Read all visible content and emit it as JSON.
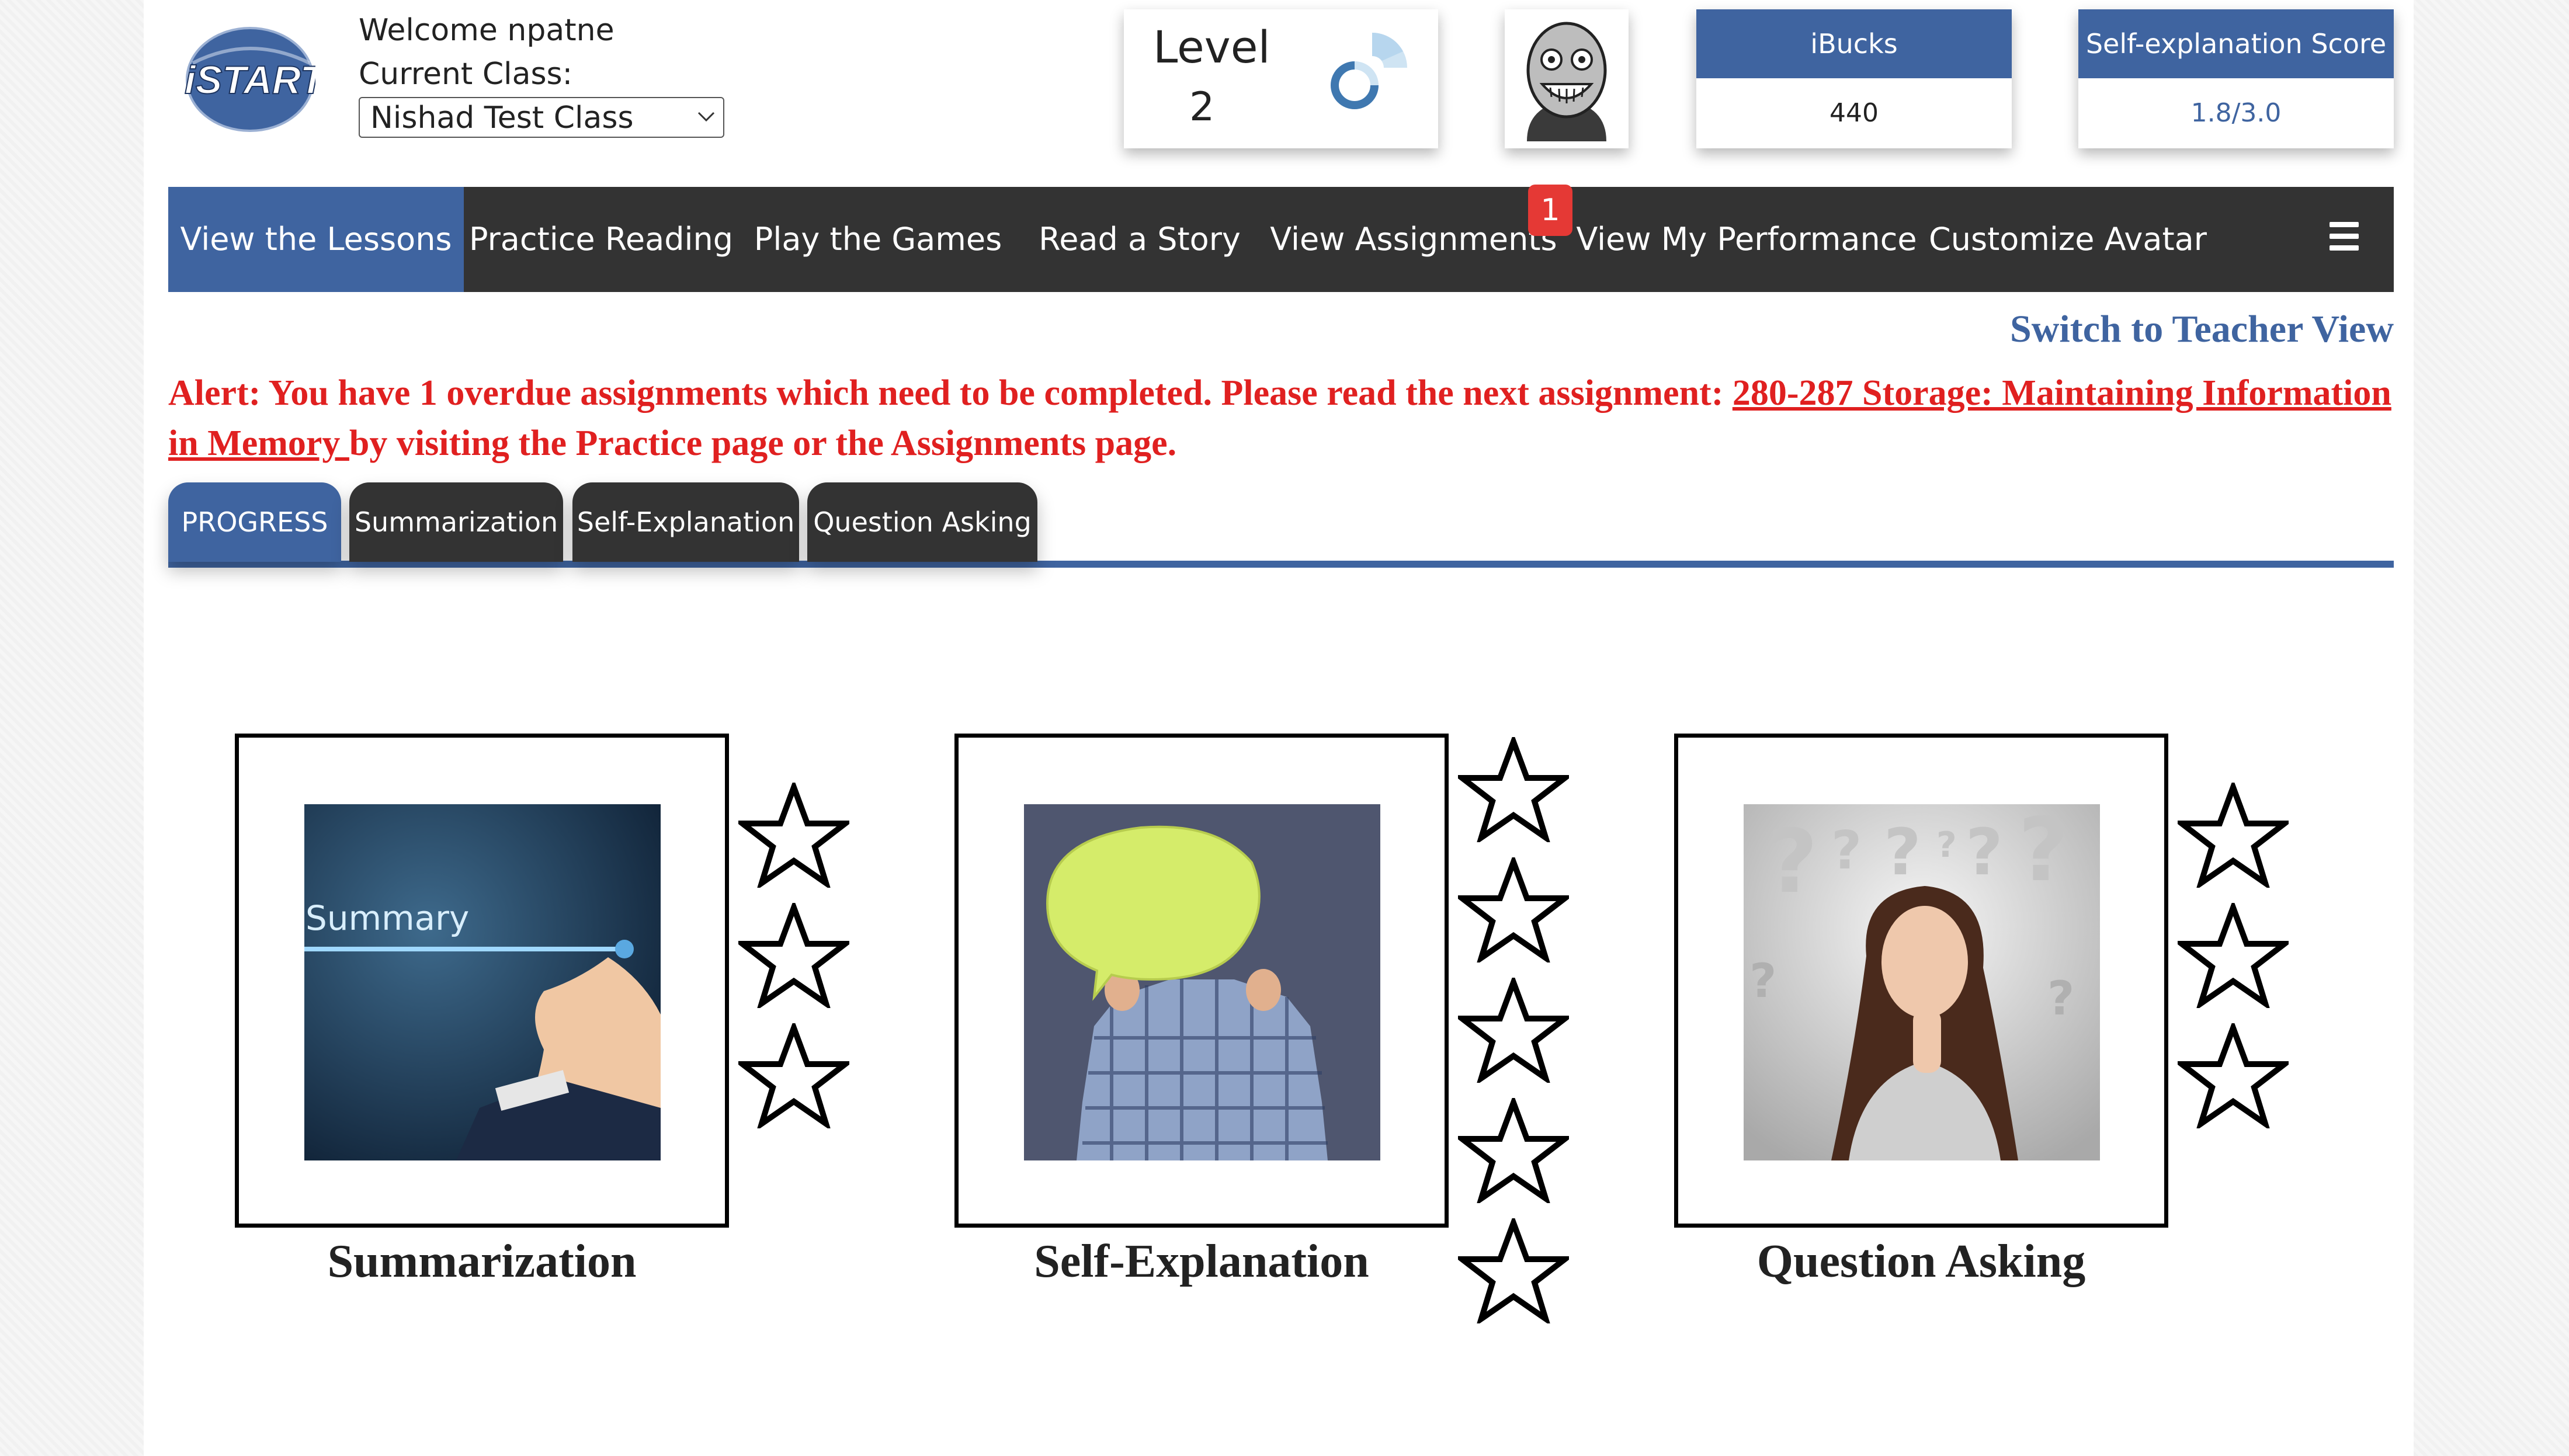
{
  "app": {
    "logo_text": "iSTART",
    "welcome": "Welcome npatne",
    "current_class_label": "Current Class:",
    "current_class_value": "Nishad Test Class"
  },
  "level": {
    "label": "Level",
    "value": "2"
  },
  "ibucks": {
    "label": "iBucks",
    "value": "440"
  },
  "self_explanation_score": {
    "label": "Self-explanation Score",
    "value": "1.8/3.0"
  },
  "nav": {
    "items": [
      {
        "label": "View the Lessons",
        "active": true
      },
      {
        "label": "Practice Reading"
      },
      {
        "label": "Play the Games"
      },
      {
        "label": "Read a Story"
      },
      {
        "label": "View Assignments",
        "badge": "1"
      },
      {
        "label": "View My Performance"
      },
      {
        "label": "Customize Avatar"
      }
    ],
    "menu_icon": "hamburger-icon"
  },
  "teacher_link": "Switch to Teacher View",
  "alert": {
    "prefix": "Alert: You have 1 overdue assignments which need to be completed. Please read the next assignment: ",
    "link": "280-287 Storage: Maintaining Information in Memory ",
    "suffix": "by visiting the Practice page or the Assignments page."
  },
  "tabs": [
    {
      "label": "PROGRESS",
      "active": true
    },
    {
      "label": "Summarization"
    },
    {
      "label": "Self-Explanation"
    },
    {
      "label": "Question Asking"
    }
  ],
  "strategies": [
    {
      "name": "Summarization",
      "image_text": "Summary",
      "stars": 3
    },
    {
      "name": "Self-Explanation",
      "stars": 5
    },
    {
      "name": "Question Asking",
      "stars": 3
    }
  ],
  "colors": {
    "primary": "#3f64a0",
    "nav_bg": "#333333",
    "alert": "#e02020",
    "badge": "#e53935"
  }
}
